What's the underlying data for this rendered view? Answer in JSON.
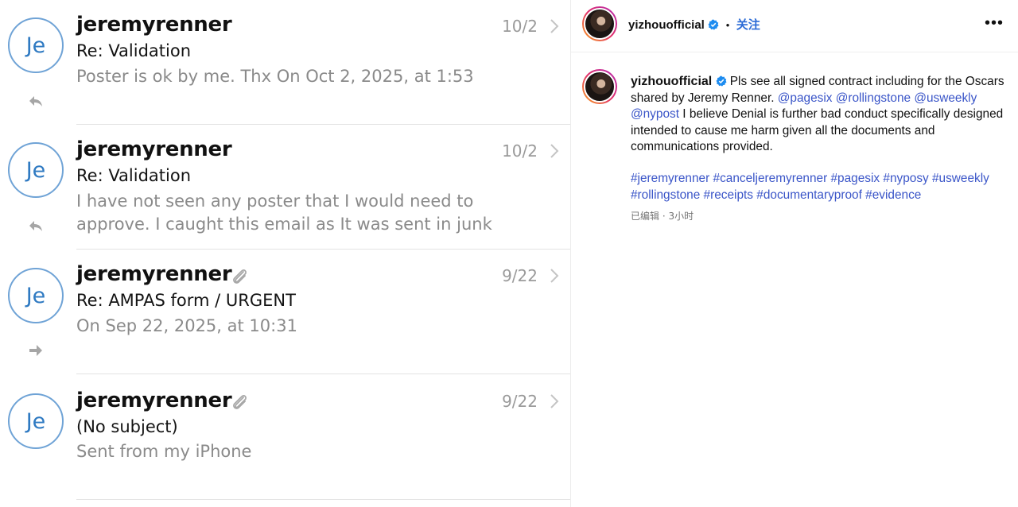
{
  "mail": {
    "rows": [
      {
        "avatar": "Je",
        "sender": "jeremyrenner",
        "date": "10/2",
        "subject": "Re: Validation",
        "preview": [
          "Poster is ok by me. Thx On Oct 2, 2025, at 1:53"
        ],
        "status_icon": "replied-icon",
        "attachment": false
      },
      {
        "avatar": "Je",
        "sender": "jeremyrenner",
        "date": "10/2",
        "subject": "Re: Validation",
        "preview": [
          "I have not seen any poster that I would need to",
          "approve. I caught this email as It was sent in junk"
        ],
        "status_icon": "replied-icon",
        "attachment": false
      },
      {
        "avatar": "Je",
        "sender": "jeremyrenner",
        "date": "9/22",
        "subject": "Re: AMPAS form / URGENT",
        "preview": [
          "On Sep 22, 2025, at 10:31"
        ],
        "status_icon": "forwarded-icon",
        "attachment": true
      },
      {
        "avatar": "Je",
        "sender": "jeremyrenner",
        "date": "9/22",
        "subject": "(No subject)",
        "preview": [
          "Sent from my iPhone"
        ],
        "status_icon": "",
        "attachment": true
      }
    ]
  },
  "ig": {
    "header": {
      "username": "yizhouofficial",
      "dot": "•",
      "follow_label": "关注",
      "more_label": "•••"
    },
    "caption": {
      "username": "yizhouofficial",
      "text_1": "Pls see all signed contract including for the Oscars shared by Jeremy Renner.",
      "mention_1": "@pagesix",
      "mention_2": "@rollingstone",
      "mention_3": "@usweekly",
      "mention_4": "@nypost",
      "text_2": "I believe Denial is further bad conduct specifically designed intended to cause me harm given all the documents and communications provided.",
      "hashtags": "#jeremyrenner #canceljeremyrenner #pagesix #nyposy #usweekly #rollingstone #receipts #documentaryproof #evidence",
      "meta": "已编辑 · 3小时"
    },
    "colors": {
      "link": "#3a55c8",
      "follow": "#2b6bd6",
      "verified": "#1d8cf0"
    }
  }
}
